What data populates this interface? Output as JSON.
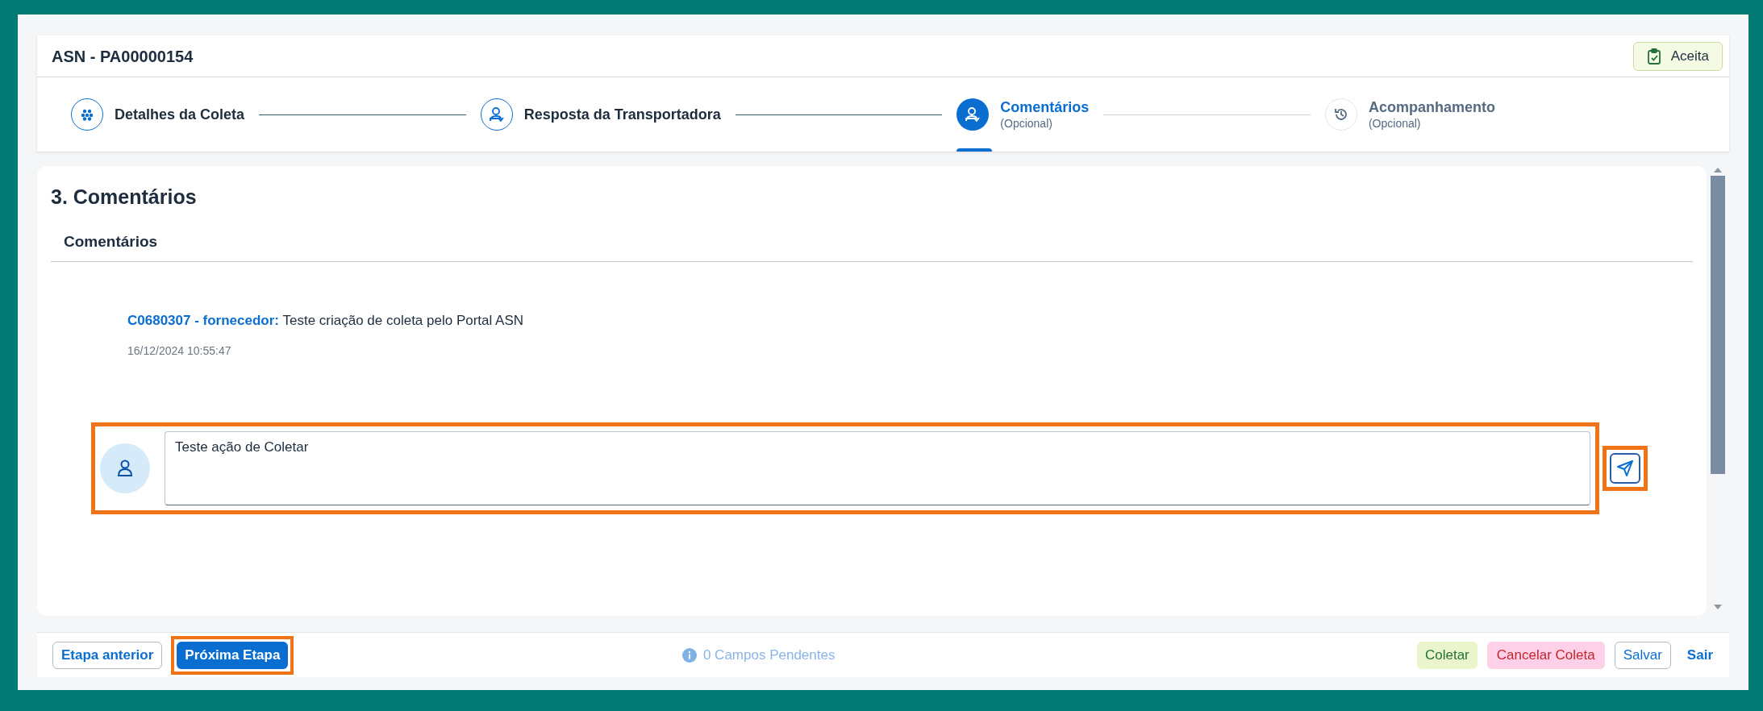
{
  "header": {
    "title": "ASN - PA00000154",
    "status_badge": "Aceita"
  },
  "steps": [
    {
      "label": "Detalhes da Coleta",
      "completed": true,
      "selected": false
    },
    {
      "label": "Resposta da Transportadora",
      "completed": true,
      "selected": false
    },
    {
      "label": "Comentários",
      "sublabel": "(Opcional)",
      "completed": false,
      "selected": true
    },
    {
      "label": "Acompanhamento",
      "sublabel": "(Opcional)",
      "completed": false,
      "selected": false
    }
  ],
  "section": {
    "title": "3. Comentários",
    "subtitle": "Comentários",
    "comments": [
      {
        "author": "C0680307 - fornecedor:",
        "text": "Teste criação de coleta pelo Portal ASN",
        "timestamp": "16/12/2024 10:55:47"
      }
    ],
    "new_comment": {
      "value": "Teste ação de Coletar",
      "highlighted": true
    },
    "send_button": {
      "highlighted": true
    }
  },
  "footer": {
    "left_buttons": [
      {
        "label": "Etapa anterior",
        "kind": "outline",
        "highlighted": false
      },
      {
        "label": "Próxima Etapa",
        "kind": "primary",
        "highlighted": true
      }
    ],
    "pending_fields": "0 Campos Pendentes",
    "right_buttons": [
      {
        "label": "Coletar",
        "kind": "success"
      },
      {
        "label": "Cancelar Coleta",
        "kind": "danger"
      },
      {
        "label": "Salvar",
        "kind": "outline"
      },
      {
        "label": "Sair",
        "kind": "link"
      }
    ]
  }
}
